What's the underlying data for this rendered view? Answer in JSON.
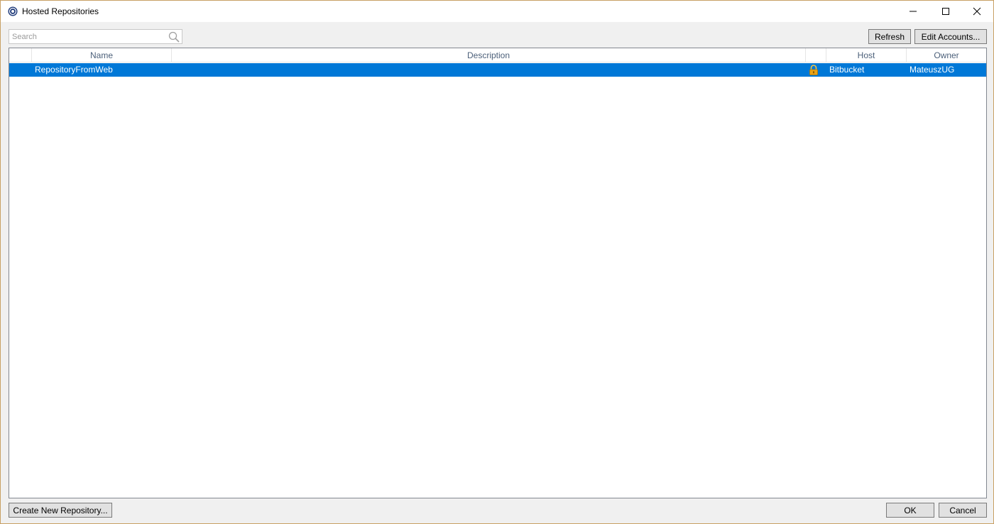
{
  "window": {
    "title": "Hosted Repositories"
  },
  "toolbar": {
    "search_placeholder": "Search",
    "search_value": "",
    "refresh_label": "Refresh",
    "edit_accounts_label": "Edit Accounts..."
  },
  "table": {
    "columns": [
      "",
      "Name",
      "Description",
      "",
      "Host",
      "Owner"
    ],
    "rows": [
      {
        "name": "RepositoryFromWeb",
        "description": "",
        "private": true,
        "host": "Bitbucket",
        "owner": "MateuszUG",
        "selected": true
      }
    ]
  },
  "footer": {
    "create_label": "Create New Repository...",
    "ok_label": "OK",
    "cancel_label": "Cancel"
  },
  "colors": {
    "selection": "#0078d7",
    "header_text": "#4c607a",
    "window_border": "#c8a064",
    "lock": "#e8a317"
  },
  "icons": {
    "app": "sourcetree-icon",
    "search": "magnifier-icon",
    "private": "lock-icon"
  }
}
